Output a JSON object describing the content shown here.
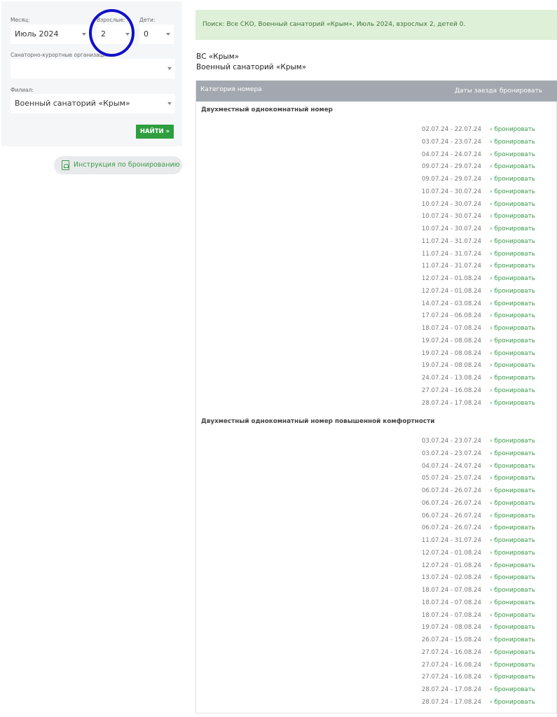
{
  "filters": {
    "month_label": "Месяц:",
    "month_value": "Июль 2024",
    "adults_label": "Взрослые:",
    "adults_value": "2",
    "children_label": "Дети:",
    "children_value": "0",
    "org_label": "Санаторно-курортные организации:",
    "org_value": "",
    "branch_label": "Филиал:",
    "branch_value": "Военный санаторий «Крым»",
    "find_button": "НАЙТИ »"
  },
  "instruction_link": "Инструкция по бронированию",
  "notice": "Поиск: Все СКО, Военный санаторий «Крым», Июль 2024, взрослых 2, детей 0.",
  "organization": {
    "line1": "ВС «Крым»",
    "line2": "Военный санаторий «Крым»"
  },
  "table": {
    "col_category": "Категория номера",
    "col_dates": "Даты заезда",
    "col_book": "бронировать",
    "book_link": "бронировать",
    "categories": [
      {
        "name": "Двухместный однокомнатный номер",
        "dates": [
          "02.07.24 - 22.07.24",
          "03.07.24 - 23.07.24",
          "04.07.24 - 24.07.24",
          "09.07.24 - 29.07.24",
          "09.07.24 - 29.07.24",
          "10.07.24 - 30.07.24",
          "10.07.24 - 30.07.24",
          "10.07.24 - 30.07.24",
          "10.07.24 - 30.07.24",
          "11.07.24 - 31.07.24",
          "11.07.24 - 31.07.24",
          "11.07.24 - 31.07.24",
          "12.07.24 - 01.08.24",
          "12.07.24 - 01.08.24",
          "14.07.24 - 03.08.24",
          "17.07.24 - 06.08.24",
          "18.07.24 - 07.08.24",
          "19.07.24 - 08.08.24",
          "19.07.24 - 08.08.24",
          "19.07.24 - 08.08.24",
          "24.07.24 - 13.08.24",
          "27.07.24 - 16.08.24",
          "28.07.24 - 17.08.24"
        ]
      },
      {
        "name": "Двухместный однокомнатный номер повышенной комфортности",
        "dates": [
          "03.07.24 - 23.07.24",
          "03.07.24 - 23.07.24",
          "04.07.24 - 24.07.24",
          "05.07.24 - 25.07.24",
          "06.07.24 - 26.07.24",
          "06.07.24 - 26.07.24",
          "06.07.24 - 26.07.24",
          "06.07.24 - 26.07.24",
          "11.07.24 - 31.07.24",
          "12.07.24 - 01.08.24",
          "12.07.24 - 01.08.24",
          "13.07.24 - 02.08.24",
          "18.07.24 - 07.08.24",
          "18.07.24 - 07.08.24",
          "18.07.24 - 07.08.24",
          "19.07.24 - 08.08.24",
          "26.07.24 - 15.08.24",
          "27.07.24 - 16.08.24",
          "27.07.24 - 16.08.24",
          "27.07.24 - 16.08.24",
          "28.07.24 - 17.08.24",
          "28.07.24 - 17.08.24"
        ]
      }
    ]
  }
}
